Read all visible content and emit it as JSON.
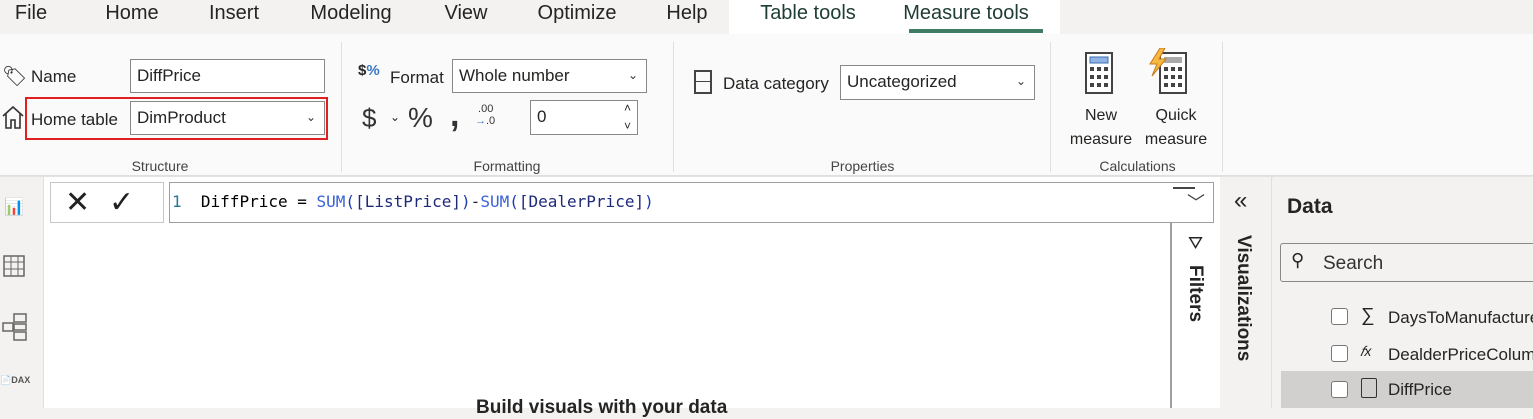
{
  "menu_tabs": [
    "File",
    "Home",
    "Insert",
    "Modeling",
    "View",
    "Optimize",
    "Help"
  ],
  "context_tabs": [
    "Table tools",
    "Measure tools"
  ],
  "active_tab": "Measure tools",
  "accent_color": "#3f7a63",
  "structure": {
    "name_label": "Name",
    "name_value": "DiffPrice",
    "home_table_label": "Home table",
    "home_table_value": "DimProduct",
    "group_label": "Structure"
  },
  "formatting": {
    "format_label": "Format",
    "format_value": "Whole number",
    "currency_symbol": "$",
    "percent_symbol": "%",
    "comma_symbol": ",",
    "decimals_value": "0",
    "group_label": "Formatting"
  },
  "properties": {
    "data_category_label": "Data category",
    "data_category_value": "Uncategorized",
    "group_label": "Properties"
  },
  "calculations": {
    "new_measure_l1": "New",
    "new_measure_l2": "measure",
    "quick_measure_l1": "Quick",
    "quick_measure_l2": "measure",
    "group_label": "Calculations"
  },
  "formula": {
    "line_number": "1",
    "name": "DiffPrice =",
    "fn1": "SUM",
    "arg1": "[ListPrice]",
    "minus": "-",
    "fn2": "SUM",
    "arg2": "[DealerPrice]"
  },
  "canvas_hint": "Build visuals with your data",
  "panes": {
    "filters": "Filters",
    "visualizations": "Visualizations",
    "data_title": "Data",
    "search_placeholder": "Search"
  },
  "fields": [
    {
      "name": "DaysToManufacture",
      "icon": "sigma-icon",
      "selected": false
    },
    {
      "name": "DealderPriceColumn",
      "icon": "calculated-column-icon",
      "selected": false
    },
    {
      "name": "DiffPrice",
      "icon": "measure-calculator-icon",
      "selected": false,
      "highlighted": true
    }
  ]
}
